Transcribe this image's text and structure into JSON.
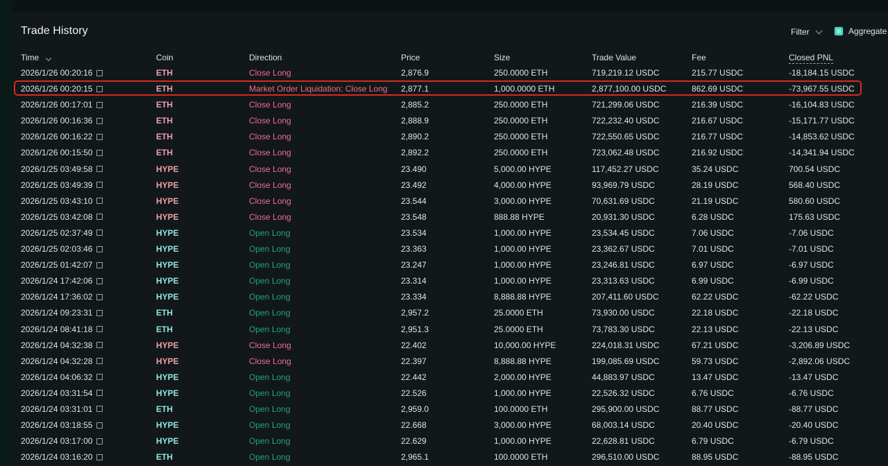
{
  "panel": {
    "title": "Trade History",
    "filter_label": "Filter",
    "aggregate_label": "Aggregate"
  },
  "columns": {
    "time": "Time",
    "coin": "Coin",
    "direction": "Direction",
    "price": "Price",
    "size": "Size",
    "trade_value": "Trade Value",
    "fee": "Fee",
    "closed_pnl": "Closed PNL"
  },
  "colors": {
    "close_direction": "#ed7088",
    "open_direction": "#1fa67d",
    "eth_coin_close": "#e9a1ad",
    "hype_coin_open": "#8fe8dc",
    "highlight_border": "#d42a24"
  },
  "rows": [
    {
      "time": "2026/1/26 00:20:16",
      "coin": "ETH",
      "direction": "Close Long",
      "price": "2,876.9",
      "size": "250.0000 ETH",
      "value": "719,219.12 USDC",
      "fee": "215.77 USDC",
      "pnl": "-18,184.15 USDC",
      "side": "close"
    },
    {
      "time": "2026/1/26 00:20:15",
      "coin": "ETH",
      "direction": "Market Order Liquidation: Close Long",
      "price": "2,877.1",
      "size": "1,000.0000 ETH",
      "value": "2,877,100.00 USDC",
      "fee": "862.69 USDC",
      "pnl": "-73,967.55 USDC",
      "side": "close",
      "highlighted": true
    },
    {
      "time": "2026/1/26 00:17:01",
      "coin": "ETH",
      "direction": "Close Long",
      "price": "2,885.2",
      "size": "250.0000 ETH",
      "value": "721,299.06 USDC",
      "fee": "216.39 USDC",
      "pnl": "-16,104.83 USDC",
      "side": "close"
    },
    {
      "time": "2026/1/26 00:16:36",
      "coin": "ETH",
      "direction": "Close Long",
      "price": "2,888.9",
      "size": "250.0000 ETH",
      "value": "722,232.40 USDC",
      "fee": "216.67 USDC",
      "pnl": "-15,171.77 USDC",
      "side": "close"
    },
    {
      "time": "2026/1/26 00:16:22",
      "coin": "ETH",
      "direction": "Close Long",
      "price": "2,890.2",
      "size": "250.0000 ETH",
      "value": "722,550.65 USDC",
      "fee": "216.77 USDC",
      "pnl": "-14,853.62 USDC",
      "side": "close"
    },
    {
      "time": "2026/1/26 00:15:50",
      "coin": "ETH",
      "direction": "Close Long",
      "price": "2,892.2",
      "size": "250.0000 ETH",
      "value": "723,062.48 USDC",
      "fee": "216.92 USDC",
      "pnl": "-14,341.94 USDC",
      "side": "close"
    },
    {
      "time": "2026/1/25 03:49:58",
      "coin": "HYPE",
      "direction": "Close Long",
      "price": "23.490",
      "size": "5,000.00 HYPE",
      "value": "117,452.27 USDC",
      "fee": "35.24 USDC",
      "pnl": "700.54 USDC",
      "side": "close"
    },
    {
      "time": "2026/1/25 03:49:39",
      "coin": "HYPE",
      "direction": "Close Long",
      "price": "23.492",
      "size": "4,000.00 HYPE",
      "value": "93,969.79 USDC",
      "fee": "28.19 USDC",
      "pnl": "568.40 USDC",
      "side": "close"
    },
    {
      "time": "2026/1/25 03:43:10",
      "coin": "HYPE",
      "direction": "Close Long",
      "price": "23.544",
      "size": "3,000.00 HYPE",
      "value": "70,631.69 USDC",
      "fee": "21.19 USDC",
      "pnl": "580.60 USDC",
      "side": "close"
    },
    {
      "time": "2026/1/25 03:42:08",
      "coin": "HYPE",
      "direction": "Close Long",
      "price": "23.548",
      "size": "888.88 HYPE",
      "value": "20,931.30 USDC",
      "fee": "6.28 USDC",
      "pnl": "175.63 USDC",
      "side": "close"
    },
    {
      "time": "2026/1/25 02:37:49",
      "coin": "HYPE",
      "direction": "Open Long",
      "price": "23.534",
      "size": "1,000.00 HYPE",
      "value": "23,534.45 USDC",
      "fee": "7.06 USDC",
      "pnl": "-7.06 USDC",
      "side": "open"
    },
    {
      "time": "2026/1/25 02:03:46",
      "coin": "HYPE",
      "direction": "Open Long",
      "price": "23.363",
      "size": "1,000.00 HYPE",
      "value": "23,362.67 USDC",
      "fee": "7.01 USDC",
      "pnl": "-7.01 USDC",
      "side": "open"
    },
    {
      "time": "2026/1/25 01:42:07",
      "coin": "HYPE",
      "direction": "Open Long",
      "price": "23.247",
      "size": "1,000.00 HYPE",
      "value": "23,246.81 USDC",
      "fee": "6.97 USDC",
      "pnl": "-6.97 USDC",
      "side": "open"
    },
    {
      "time": "2026/1/24 17:42:06",
      "coin": "HYPE",
      "direction": "Open Long",
      "price": "23.314",
      "size": "1,000.00 HYPE",
      "value": "23,313.63 USDC",
      "fee": "6.99 USDC",
      "pnl": "-6.99 USDC",
      "side": "open"
    },
    {
      "time": "2026/1/24 17:36:02",
      "coin": "HYPE",
      "direction": "Open Long",
      "price": "23.334",
      "size": "8,888.88 HYPE",
      "value": "207,411.60 USDC",
      "fee": "62.22 USDC",
      "pnl": "-62.22 USDC",
      "side": "open"
    },
    {
      "time": "2026/1/24 09:23:31",
      "coin": "ETH",
      "direction": "Open Long",
      "price": "2,957.2",
      "size": "25.0000 ETH",
      "value": "73,930.00 USDC",
      "fee": "22.18 USDC",
      "pnl": "-22.18 USDC",
      "side": "open"
    },
    {
      "time": "2026/1/24 08:41:18",
      "coin": "ETH",
      "direction": "Open Long",
      "price": "2,951.3",
      "size": "25.0000 ETH",
      "value": "73,783.30 USDC",
      "fee": "22.13 USDC",
      "pnl": "-22.13 USDC",
      "side": "open"
    },
    {
      "time": "2026/1/24 04:32:38",
      "coin": "HYPE",
      "direction": "Close Long",
      "price": "22.402",
      "size": "10,000.00 HYPE",
      "value": "224,018.31 USDC",
      "fee": "67.21 USDC",
      "pnl": "-3,206.89 USDC",
      "side": "close"
    },
    {
      "time": "2026/1/24 04:32:28",
      "coin": "HYPE",
      "direction": "Close Long",
      "price": "22.397",
      "size": "8,888.88 HYPE",
      "value": "199,085.69 USDC",
      "fee": "59.73 USDC",
      "pnl": "-2,892.06 USDC",
      "side": "close"
    },
    {
      "time": "2026/1/24 04:06:32",
      "coin": "HYPE",
      "direction": "Open Long",
      "price": "22.442",
      "size": "2,000.00 HYPE",
      "value": "44,883.97 USDC",
      "fee": "13.47 USDC",
      "pnl": "-13.47 USDC",
      "side": "open"
    },
    {
      "time": "2026/1/24 03:31:54",
      "coin": "HYPE",
      "direction": "Open Long",
      "price": "22.526",
      "size": "1,000.00 HYPE",
      "value": "22,526.32 USDC",
      "fee": "6.76 USDC",
      "pnl": "-6.76 USDC",
      "side": "open"
    },
    {
      "time": "2026/1/24 03:31:01",
      "coin": "ETH",
      "direction": "Open Long",
      "price": "2,959.0",
      "size": "100.0000 ETH",
      "value": "295,900.00 USDC",
      "fee": "88.77 USDC",
      "pnl": "-88.77 USDC",
      "side": "open"
    },
    {
      "time": "2026/1/24 03:18:55",
      "coin": "HYPE",
      "direction": "Open Long",
      "price": "22.668",
      "size": "3,000.00 HYPE",
      "value": "68,003.14 USDC",
      "fee": "20.40 USDC",
      "pnl": "-20.40 USDC",
      "side": "open"
    },
    {
      "time": "2026/1/24 03:17:00",
      "coin": "HYPE",
      "direction": "Open Long",
      "price": "22.629",
      "size": "1,000.00 HYPE",
      "value": "22,628.81 USDC",
      "fee": "6.79 USDC",
      "pnl": "-6.79 USDC",
      "side": "open"
    },
    {
      "time": "2026/1/24 03:16:20",
      "coin": "ETH",
      "direction": "Open Long",
      "price": "2,965.1",
      "size": "100.0000 ETH",
      "value": "296,510.00 USDC",
      "fee": "88.95 USDC",
      "pnl": "-88.95 USDC",
      "side": "open"
    }
  ]
}
